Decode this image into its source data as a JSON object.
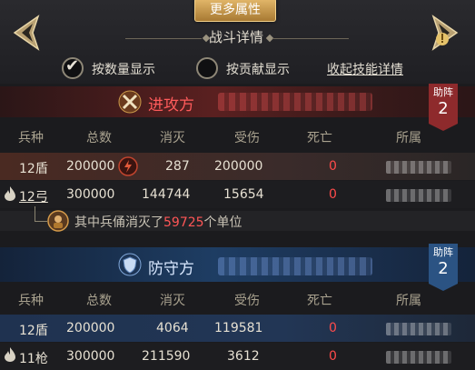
{
  "top": {
    "more_button": "更多属性",
    "title": "战斗详情",
    "option_count": "按数量显示",
    "option_contrib": "按贡献显示",
    "collapse_link": "收起技能详情"
  },
  "attacker": {
    "title": "进攻方",
    "support_label": "助阵",
    "support_count": "2",
    "headers": [
      "兵种",
      "总数",
      "消灭",
      "受伤",
      "死亡",
      "所属"
    ],
    "rows": [
      {
        "type": "12盾",
        "total": "200000",
        "killed": "287",
        "wounded": "200000",
        "dead": "0"
      },
      {
        "type": "12弓",
        "total": "300000",
        "killed": "144744",
        "wounded": "15654",
        "dead": "0"
      }
    ],
    "note_prefix": "其中兵俑消灭了",
    "note_number": "59725",
    "note_suffix": "个单位"
  },
  "defender": {
    "title": "防守方",
    "support_label": "助阵",
    "support_count": "2",
    "headers": [
      "兵种",
      "总数",
      "消灭",
      "受伤",
      "死亡",
      "所属"
    ],
    "rows": [
      {
        "type": "12盾",
        "total": "200000",
        "killed": "4064",
        "wounded": "119581",
        "dead": "0"
      },
      {
        "type": "11枪",
        "total": "300000",
        "killed": "211590",
        "wounded": "3612",
        "dead": "0"
      }
    ]
  },
  "colors": {
    "attacker_accent": "#ff5b5b",
    "defender_accent": "#2b5383",
    "dead_count": "#ff4b4b",
    "gold_button": "#c99a4e"
  },
  "icons": {
    "nav_prev": "chevron-left-icon",
    "nav_next": "chevron-right-icon",
    "attacker": "crossed-swords-icon",
    "defender": "shield-icon"
  }
}
